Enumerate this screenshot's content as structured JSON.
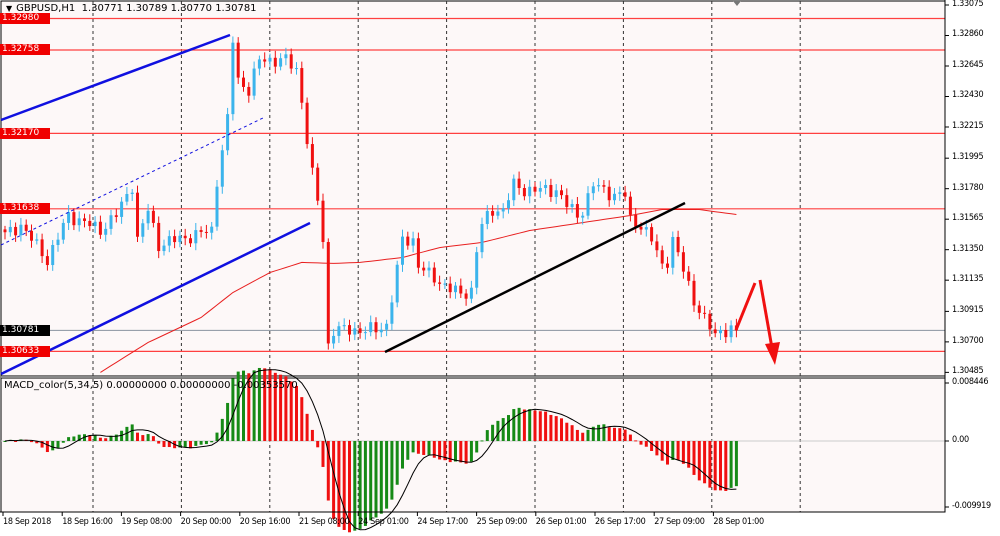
{
  "header": {
    "symbol": "GBPUSD,H1",
    "ohlc": "1.30771 1.30789 1.30770 1.30781"
  },
  "macd_header": {
    "title": "MACD_color(5,34,5)",
    "values": "0.00000000 0.00000000 -0.00353570"
  },
  "colors": {
    "background": "#fdf8f8",
    "bull": "#3bb4ec",
    "bear": "#f01010",
    "hline": "#ff4040",
    "channel": "#1010e0",
    "trendline": "#000000",
    "ma": "#e82020",
    "macd_up": "#168a16",
    "macd_down": "#f01010"
  },
  "price_axis": {
    "labels": [
      "1.33075",
      "1.32860",
      "1.32645",
      "1.32430",
      "1.32215",
      "1.31995",
      "1.31780",
      "1.31565",
      "1.31350",
      "1.31135",
      "1.30915",
      "1.30700",
      "1.30485"
    ]
  },
  "price_tags": [
    {
      "label": "1.32980",
      "kind": "level"
    },
    {
      "label": "1.32758",
      "kind": "level"
    },
    {
      "label": "1.32170",
      "kind": "level"
    },
    {
      "label": "1.31638",
      "kind": "level"
    },
    {
      "label": "1.30633",
      "kind": "level"
    },
    {
      "label": "1.30781",
      "kind": "bid"
    }
  ],
  "macd_axis": {
    "labels": [
      "0.008446",
      "0.00",
      "-0.009919"
    ]
  },
  "time_axis": {
    "labels": [
      "18 Sep 2018",
      "18 Sep 16:00",
      "19 Sep 08:00",
      "20 Sep 00:00",
      "20 Sep 16:00",
      "21 Sep 08:00",
      "24 Sep 01:00",
      "24 Sep 17:00",
      "25 Sep 09:00",
      "26 Sep 01:00",
      "26 Sep 17:00",
      "27 Sep 09:00",
      "28 Sep 01:00"
    ]
  },
  "chart_data": {
    "type": "candlestick",
    "symbol": "GBPUSD",
    "timeframe": "H1",
    "ylim": [
      1.30485,
      1.33075
    ],
    "bars": 139,
    "close_keypoints": [
      [
        0,
        1.31453
      ],
      [
        3,
        1.31524
      ],
      [
        8,
        1.31277
      ],
      [
        12,
        1.31594
      ],
      [
        18,
        1.31489
      ],
      [
        21,
        1.31594
      ],
      [
        24,
        1.31806
      ],
      [
        25,
        1.31418
      ],
      [
        27,
        1.3163
      ],
      [
        29,
        1.31383
      ],
      [
        32,
        1.31418
      ],
      [
        36,
        1.31453
      ],
      [
        39,
        1.31489
      ],
      [
        40,
        1.31841
      ],
      [
        42,
        1.32264
      ],
      [
        43,
        1.32828
      ],
      [
        44,
        1.32546
      ],
      [
        46,
        1.32476
      ],
      [
        48,
        1.32687
      ],
      [
        50,
        1.32687
      ],
      [
        53,
        1.32687
      ],
      [
        55,
        1.32617
      ],
      [
        56,
        1.32405
      ],
      [
        57,
        1.32123
      ],
      [
        58,
        1.31876
      ],
      [
        59,
        1.317
      ],
      [
        60,
        1.31418
      ],
      [
        61,
        1.30678
      ],
      [
        62,
        1.30784
      ],
      [
        64,
        1.30784
      ],
      [
        67,
        1.30784
      ],
      [
        70,
        1.30784
      ],
      [
        72,
        1.30819
      ],
      [
        74,
        1.31207
      ],
      [
        75,
        1.31418
      ],
      [
        77,
        1.31418
      ],
      [
        78,
        1.31242
      ],
      [
        80,
        1.31171
      ],
      [
        83,
        1.31101
      ],
      [
        86,
        1.3103
      ],
      [
        88,
        1.31066
      ],
      [
        89,
        1.31348
      ],
      [
        90,
        1.31524
      ],
      [
        92,
        1.3163
      ],
      [
        94,
        1.3163
      ],
      [
        96,
        1.31806
      ],
      [
        98,
        1.31771
      ],
      [
        101,
        1.31771
      ],
      [
        104,
        1.31771
      ],
      [
        106,
        1.31665
      ],
      [
        108,
        1.31594
      ],
      [
        109,
        1.3163
      ],
      [
        111,
        1.31806
      ],
      [
        113,
        1.31771
      ],
      [
        115,
        1.31735
      ],
      [
        117,
        1.31735
      ],
      [
        118,
        1.31559
      ],
      [
        120,
        1.31524
      ],
      [
        122,
        1.31418
      ],
      [
        124,
        1.31242
      ],
      [
        125,
        1.31277
      ],
      [
        126,
        1.31418
      ],
      [
        128,
        1.31207
      ],
      [
        130,
        1.30995
      ],
      [
        132,
        1.30854
      ],
      [
        134,
        1.30748
      ],
      [
        135,
        1.30784
      ],
      [
        138,
        1.30781
      ]
    ],
    "levels": [
      1.3298,
      1.32758,
      1.3217,
      1.31638,
      1.30633
    ],
    "bid": 1.30781,
    "ma_keypoints": [
      [
        18,
        1.30485
      ],
      [
        27,
        1.30696
      ],
      [
        37,
        1.30872
      ],
      [
        43,
        1.31048
      ],
      [
        50,
        1.31189
      ],
      [
        56,
        1.3126
      ],
      [
        62,
        1.31253
      ],
      [
        67,
        1.3126
      ],
      [
        75,
        1.31295
      ],
      [
        82,
        1.31365
      ],
      [
        90,
        1.31401
      ],
      [
        99,
        1.31485
      ],
      [
        109,
        1.31541
      ],
      [
        118,
        1.31591
      ],
      [
        124,
        1.31633
      ],
      [
        131,
        1.31633
      ],
      [
        138,
        1.31598
      ]
    ],
    "macd": {
      "fast": 5,
      "slow": 34,
      "signal": 5,
      "ylim": [
        -0.009919,
        0.008446
      ]
    }
  }
}
